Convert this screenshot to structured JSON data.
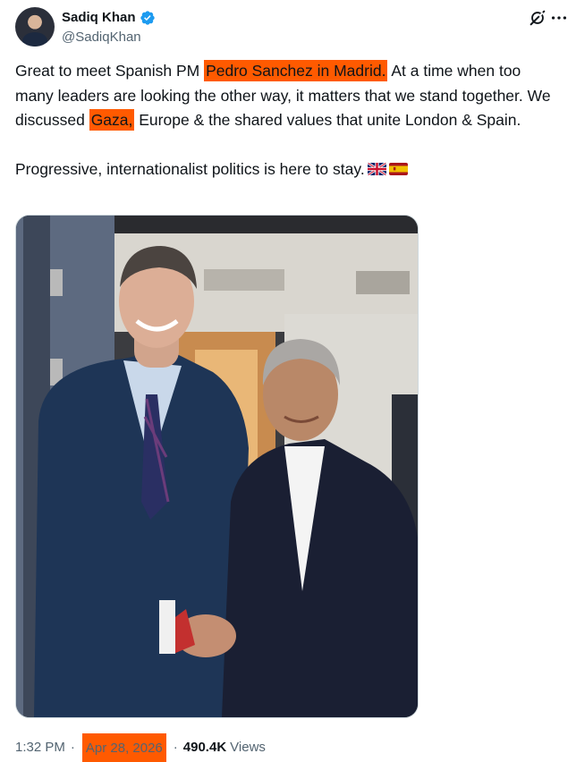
{
  "author": {
    "display_name": "Sadiq Khan",
    "handle": "@SadiqKhan",
    "verified": true
  },
  "post": {
    "segments": [
      {
        "text": "Great to meet Spanish PM ",
        "highlight": false
      },
      {
        "text": "Pedro Sanchez in Madrid.",
        "highlight": true
      },
      {
        "text": " At a time when too many leaders are looking the other way, it matters that we stand together. We discussed ",
        "highlight": false
      },
      {
        "text": "Gaza,",
        "highlight": true
      },
      {
        "text": " Europe & the shared values that unite London & Spain.",
        "highlight": false
      }
    ],
    "line2": "Progressive, internationalist politics is here to stay.",
    "flags": [
      "uk-flag-icon",
      "spain-flag-icon"
    ]
  },
  "meta": {
    "time": "1:32 PM",
    "separator": "·",
    "date": "Apr 28, 2026",
    "views_count": "490.4K",
    "views_label": "Views"
  },
  "colors": {
    "highlight": "#ff5a00",
    "verified": "#1d9bf0",
    "secondary_text": "#536471"
  }
}
